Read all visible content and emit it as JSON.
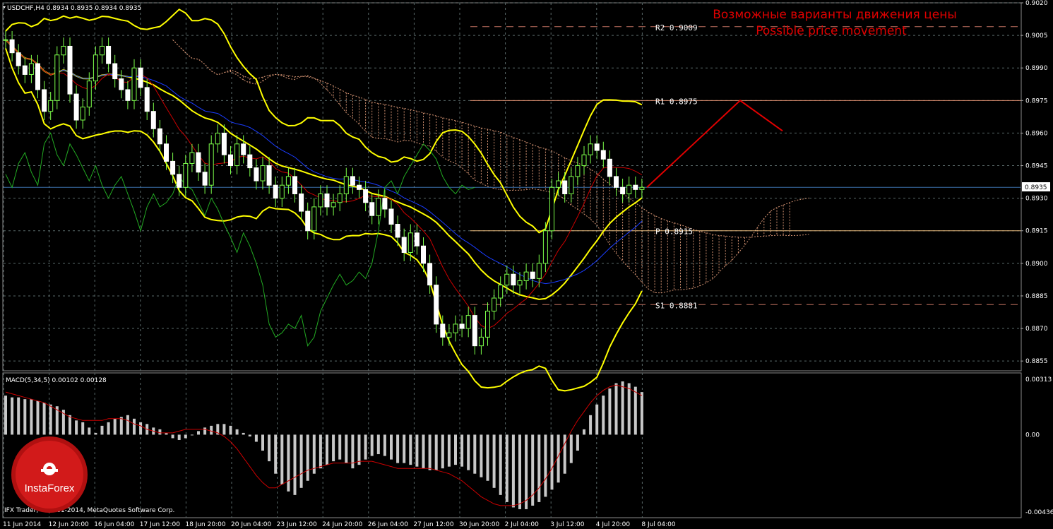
{
  "window": {
    "symbol_header": "USDCHF,H4  0.8934 0.8935 0.8934 0.8935"
  },
  "annotation": {
    "line_ru": "Возможные варианты движения цены",
    "line_en": "Possible price movement"
  },
  "levels": [
    {
      "label": "R2  0.9009",
      "value": 0.9009,
      "color": "#c07060",
      "dash": true
    },
    {
      "label": "R1  0.8975",
      "value": 0.8975,
      "color": "#e09070",
      "dash": false
    },
    {
      "label": "P  0.8915",
      "value": 0.8915,
      "color": "#f0c080",
      "dash": false
    },
    {
      "label": "S1  0.8881",
      "value": 0.8881,
      "color": "#c07060",
      "dash": true
    }
  ],
  "current_price": {
    "label": "0.8935",
    "value": 0.8935
  },
  "chart_data": [
    {
      "type": "candlestick",
      "title": "USDCHF,H4",
      "ylim": [
        0.88505,
        0.902
      ],
      "y_ticks": [
        "0.9020",
        "0.9005",
        "0.8990",
        "0.8975",
        "0.8960",
        "0.8945",
        "0.8930",
        "0.8915",
        "0.8900",
        "0.8885",
        "0.8870",
        "0.8855"
      ],
      "y_tick_values": [
        0.902,
        0.9005,
        0.899,
        0.8975,
        0.896,
        0.8945,
        0.893,
        0.8915,
        0.89,
        0.8885,
        0.887,
        0.8855
      ],
      "x_labels": [
        "11 Jun 2014",
        "12 Jun 20:00",
        "16 Jun 04:00",
        "17 Jun 12:00",
        "18 Jun 20:00",
        "20 Jun 04:00",
        "23 Jun 12:00",
        "24 Jun 20:00",
        "26 Jun 04:00",
        "27 Jun 12:00",
        "30 Jun 20:00",
        "2 Jul 04:00",
        "3 Jul 12:00",
        "4 Jul 20:00",
        "8 Jul 04:00"
      ],
      "closes": [
        0.9003,
        0.8997,
        0.8991,
        0.8987,
        0.8992,
        0.898,
        0.897,
        0.8975,
        0.8996,
        0.9,
        0.8978,
        0.8966,
        0.8972,
        0.8984,
        0.8996,
        0.9,
        0.8992,
        0.8985,
        0.898,
        0.8975,
        0.899,
        0.8981,
        0.897,
        0.8962,
        0.8955,
        0.8947,
        0.8941,
        0.8935,
        0.8946,
        0.8951,
        0.8942,
        0.8936,
        0.8955,
        0.896,
        0.895,
        0.8945,
        0.8955,
        0.895,
        0.8944,
        0.8938,
        0.8945,
        0.8936,
        0.893,
        0.8936,
        0.894,
        0.8932,
        0.8924,
        0.8915,
        0.8926,
        0.8932,
        0.8926,
        0.8928,
        0.8932,
        0.894,
        0.8936,
        0.8934,
        0.8928,
        0.8922,
        0.893,
        0.8925,
        0.8918,
        0.8912,
        0.8905,
        0.8914,
        0.8908,
        0.89,
        0.889,
        0.8872,
        0.8866,
        0.8868,
        0.8872,
        0.887,
        0.8876,
        0.8862,
        0.8866,
        0.8878,
        0.8884,
        0.889,
        0.8895,
        0.889,
        0.8892,
        0.8896,
        0.8893,
        0.89,
        0.8915,
        0.8935,
        0.8938,
        0.8932,
        0.894,
        0.8945,
        0.895,
        0.8955,
        0.8952,
        0.8948,
        0.894,
        0.8935,
        0.8932,
        0.8936,
        0.8934,
        0.8935
      ],
      "macd": {
        "title": "MACD(5,34,5) 0.00102 0.00128",
        "ylim": [
          -0.0046,
          0.0034
        ],
        "y_ticks": [
          "0.00313",
          "0.00",
          "-0.00436"
        ],
        "y_tick_values": [
          0.00313,
          0.0,
          -0.00436
        ],
        "histogram": [
          0.0022,
          0.0021,
          0.0021,
          0.002,
          0.002,
          0.0019,
          0.0018,
          0.0017,
          0.0016,
          0.0014,
          0.0011,
          0.0008,
          0.0007,
          0.0004,
          0.0001,
          0.0005,
          0.0007,
          0.0009,
          0.001,
          0.0011,
          0.0009,
          0.0007,
          0.0006,
          0.0004,
          0.0003,
          0.0001,
          -0.0002,
          -0.0003,
          -0.0002,
          0.0,
          0.0002,
          0.0004,
          0.0005,
          0.0006,
          0.0006,
          0.0005,
          0.0003,
          0.0001,
          -0.0001,
          -0.0004,
          -0.0009,
          -0.0015,
          -0.0022,
          -0.0028,
          -0.0032,
          -0.0034,
          -0.003,
          -0.0026,
          -0.0022,
          -0.0019,
          -0.0017,
          -0.0015,
          -0.0014,
          -0.0016,
          -0.0019,
          -0.0017,
          -0.0014,
          -0.0012,
          -0.0011,
          -0.0012,
          -0.0014,
          -0.0016,
          -0.0016,
          -0.0017,
          -0.0018,
          -0.0019,
          -0.002,
          -0.002,
          -0.0019,
          -0.0018,
          -0.0017,
          -0.0018,
          -0.002,
          -0.0022,
          -0.0024,
          -0.0026,
          -0.003,
          -0.0034,
          -0.0038,
          -0.0041,
          -0.0042,
          -0.0042,
          -0.004,
          -0.0038,
          -0.0035,
          -0.0031,
          -0.0027,
          -0.0022,
          -0.0016,
          -0.0009,
          0.0003,
          0.0011,
          0.0017,
          0.0022,
          0.0026,
          0.0029,
          0.003,
          0.0029,
          0.0027,
          0.0024
        ],
        "signal": [
          0.0024,
          0.0023,
          0.0022,
          0.0021,
          0.002,
          0.0019,
          0.0018,
          0.0016,
          0.0014,
          0.0012,
          0.001,
          0.0009,
          0.0008,
          0.0008,
          0.0008,
          0.0008,
          0.0009,
          0.0009,
          0.0009,
          0.0008,
          0.0006,
          0.0005,
          0.0003,
          0.0002,
          0.0001,
          0.0001,
          0.0001,
          0.0002,
          0.0003,
          0.0003,
          0.0003,
          0.0003,
          0.0002,
          0.0001,
          -0.0001,
          -0.0004,
          -0.0008,
          -0.0013,
          -0.0018,
          -0.0023,
          -0.0027,
          -0.003,
          -0.003,
          -0.0028,
          -0.0026,
          -0.0024,
          -0.0022,
          -0.002,
          -0.0019,
          -0.0018,
          -0.0017,
          -0.0016,
          -0.0016,
          -0.0016,
          -0.0016,
          -0.0015,
          -0.0015,
          -0.0015,
          -0.0016,
          -0.0017,
          -0.0018,
          -0.0019,
          -0.0019,
          -0.0019,
          -0.0019,
          -0.0019,
          -0.0019,
          -0.002,
          -0.0021,
          -0.0022,
          -0.0024,
          -0.0026,
          -0.0029,
          -0.0032,
          -0.0035,
          -0.0037,
          -0.0039,
          -0.004,
          -0.004,
          -0.004,
          -0.0039,
          -0.0037,
          -0.0034,
          -0.003,
          -0.0025,
          -0.0019,
          -0.0012,
          -0.0005,
          0.0002,
          0.0008,
          0.0013,
          0.0018,
          0.0022,
          0.0025,
          0.0027,
          0.0028,
          0.0027,
          0.0026,
          0.0024,
          0.0022
        ]
      }
    }
  ],
  "footer": {
    "copyright": "IFX Trader, © 2001-2014, MetaQuotes Software Corp."
  },
  "logo": {
    "text": "InstaForex"
  },
  "colors": {
    "bollinger": "#ffff00",
    "tenkan": "#cc0000",
    "kijun": "#1a3cff",
    "chikou": "#22aa22",
    "projection": "#e00000",
    "cloud": "#d09070",
    "grid": "#5a6a6a"
  }
}
